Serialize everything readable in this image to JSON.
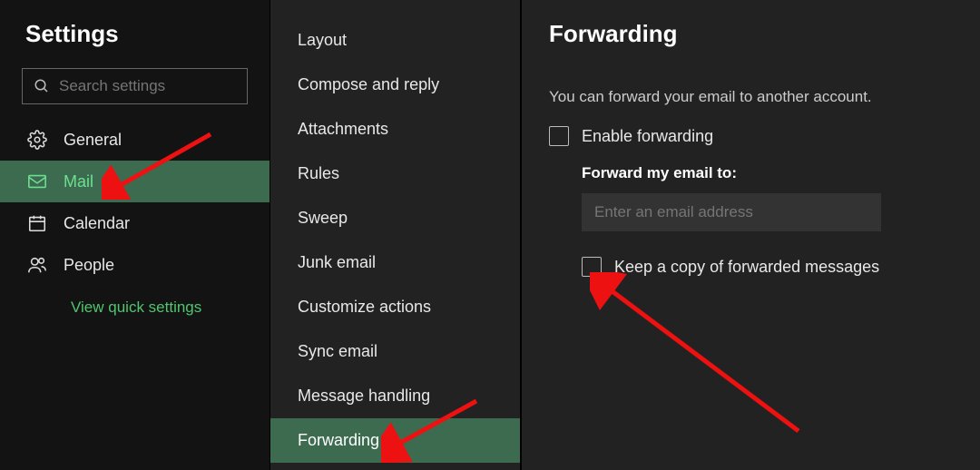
{
  "sidebar": {
    "title": "Settings",
    "search_placeholder": "Search settings",
    "items": [
      {
        "id": "general",
        "label": "General",
        "active": false
      },
      {
        "id": "mail",
        "label": "Mail",
        "active": true
      },
      {
        "id": "calendar",
        "label": "Calendar",
        "active": false
      },
      {
        "id": "people",
        "label": "People",
        "active": false
      }
    ],
    "quick_link": "View quick settings"
  },
  "subnav": {
    "items": [
      {
        "label": "Layout",
        "active": false
      },
      {
        "label": "Compose and reply",
        "active": false
      },
      {
        "label": "Attachments",
        "active": false
      },
      {
        "label": "Rules",
        "active": false
      },
      {
        "label": "Sweep",
        "active": false
      },
      {
        "label": "Junk email",
        "active": false
      },
      {
        "label": "Customize actions",
        "active": false
      },
      {
        "label": "Sync email",
        "active": false
      },
      {
        "label": "Message handling",
        "active": false
      },
      {
        "label": "Forwarding",
        "active": true
      }
    ]
  },
  "main": {
    "title": "Forwarding",
    "description": "You can forward your email to another account.",
    "enable_label": "Enable forwarding",
    "enable_checked": false,
    "forward_to_label": "Forward my email to:",
    "forward_to_placeholder": "Enter an email address",
    "forward_to_value": "",
    "keep_copy_label": "Keep a copy of forwarded messages",
    "keep_copy_checked": false
  },
  "annotations": {
    "arrow1": "points to Mail nav item",
    "arrow2": "points to Forwarding subnav item",
    "arrow3": "points to Keep a copy checkbox"
  }
}
